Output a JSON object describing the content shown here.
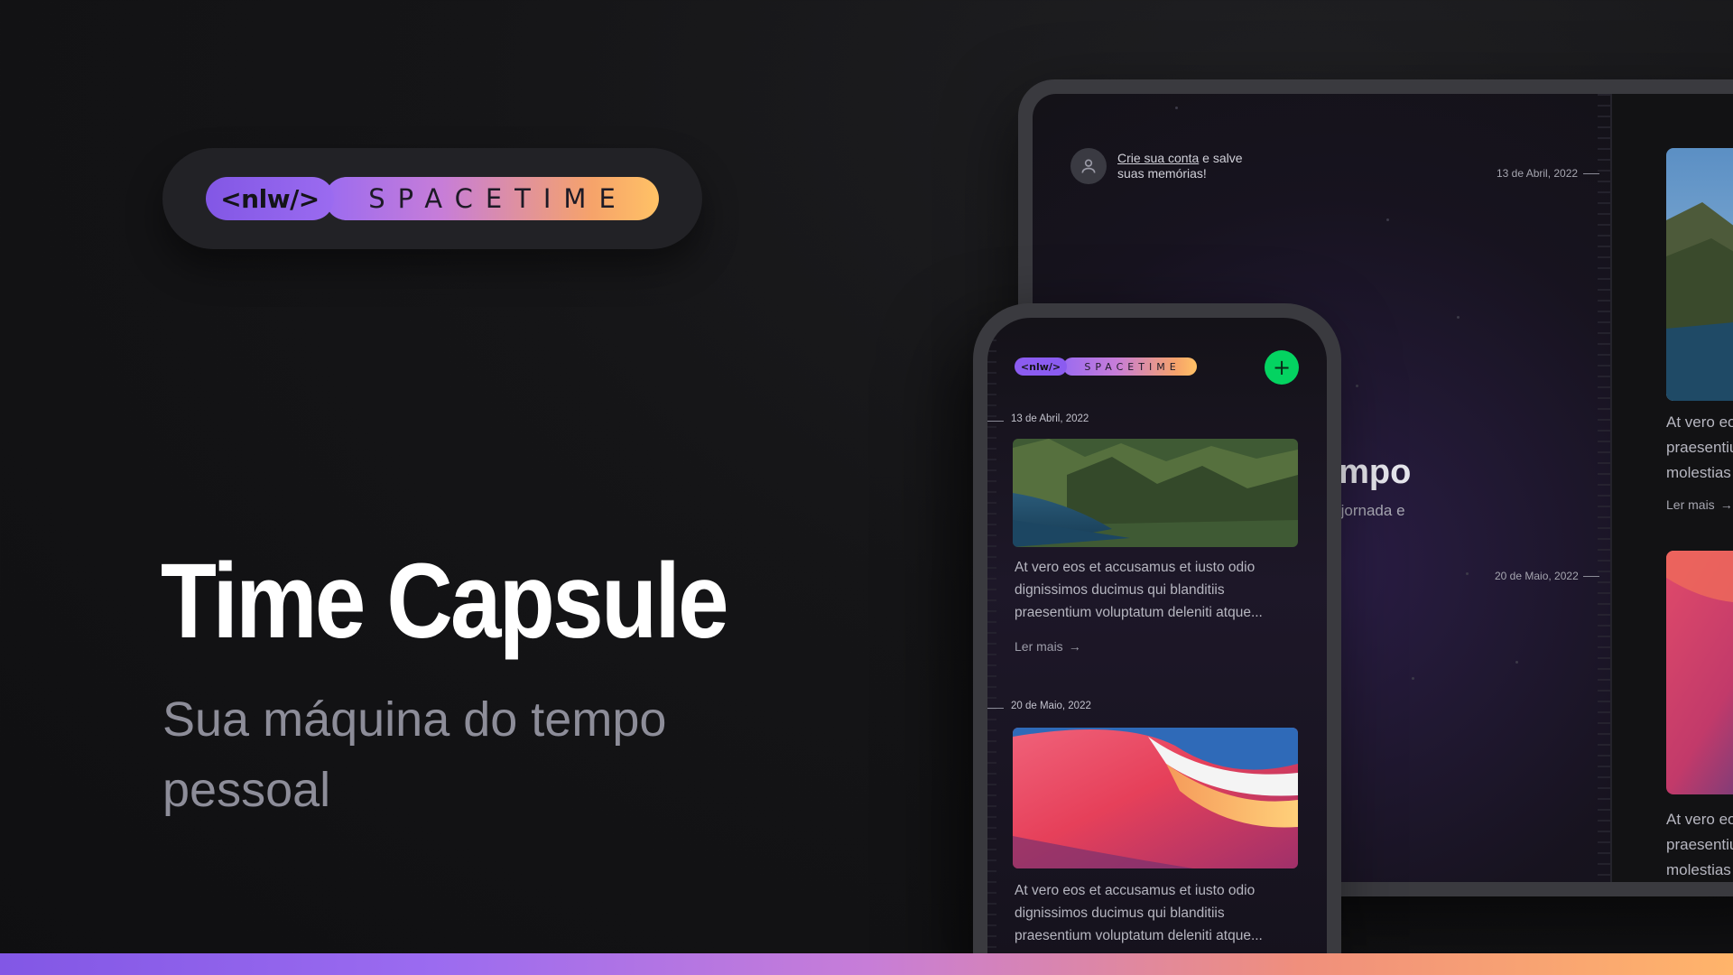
{
  "brand": {
    "tag": "<nlw/>",
    "word": "SPACETIME"
  },
  "hero": {
    "title": "Time Capsule",
    "subtitle": "Sua máquina do tempo pessoal"
  },
  "tablet": {
    "account_link": "Crie sua conta",
    "account_rest": "e salve suas memórias!",
    "partial_title": "empo",
    "partial_subtitle": "ua jornada e",
    "memories": [
      {
        "date": "13 de Abril, 2022",
        "excerpt": [
          "At vero eos",
          "praesentium",
          "molestias e"
        ],
        "read_more": "Ler mais"
      },
      {
        "date": "20 de Maio, 2022",
        "excerpt": [
          "At vero eos",
          "praesentium",
          "molestias e"
        ]
      }
    ]
  },
  "phone": {
    "add_icon": "plus-icon",
    "memories": [
      {
        "date": "13 de Abril, 2022",
        "excerpt": "At vero eos et accusamus et iusto odio dignissimos ducimus qui blanditiis praesentium voluptatum deleniti atque...",
        "read_more": "Ler mais"
      },
      {
        "date": "20 de Maio, 2022",
        "excerpt": "At vero eos et accusamus et iusto odio dignissimos ducimus qui blanditiis praesentium voluptatum deleniti atque..."
      }
    ]
  },
  "colors": {
    "accent_purple": "#8257e5",
    "accent_green": "#04d361",
    "gradient_end": "#ffb46a"
  }
}
